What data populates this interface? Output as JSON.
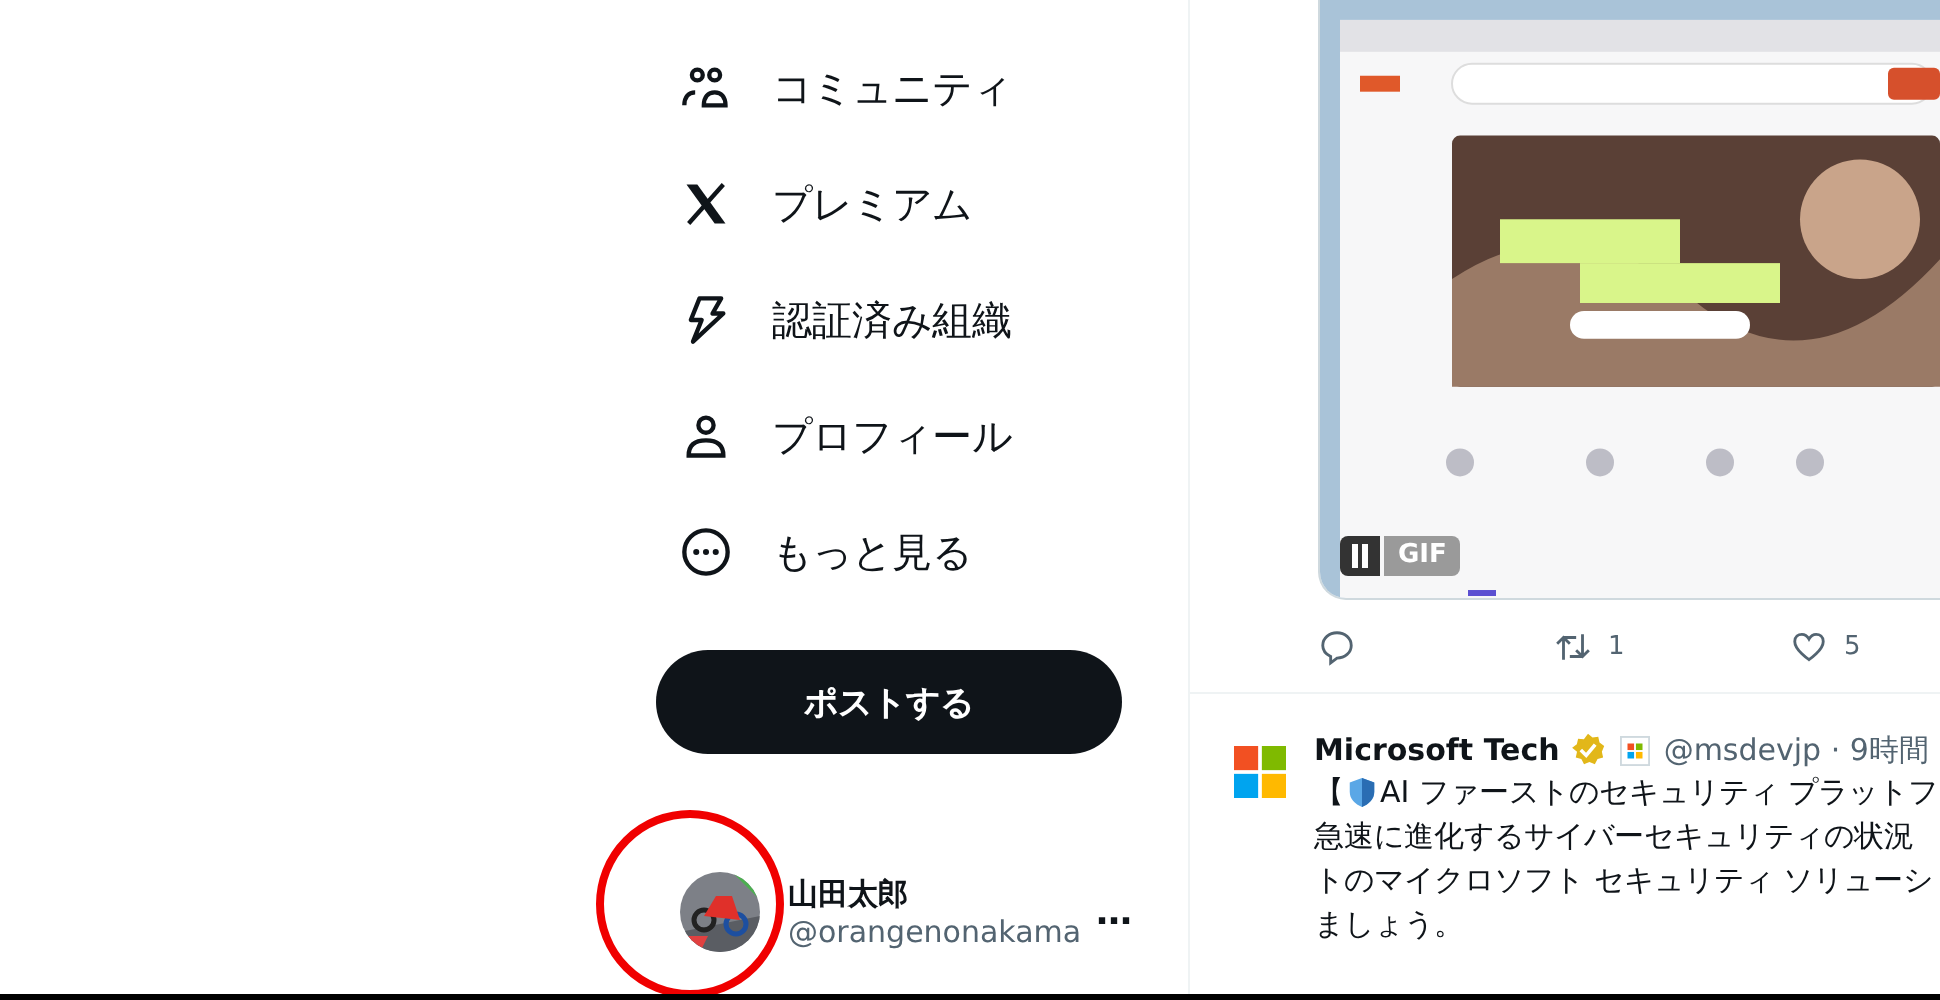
{
  "nav_items": [
    {
      "label": "コミュニティ"
    },
    {
      "label": "プレミアム"
    },
    {
      "label": "認証済み組織"
    },
    {
      "label": "プロフィール"
    },
    {
      "label": "もっと見る"
    }
  ],
  "post_button": "ポストする",
  "account": {
    "name": "山田太郎",
    "handle": "@orangenonakama",
    "more": "…"
  },
  "tweets": [
    {
      "media": {
        "kind": "picture",
        "badge": "GIF"
      },
      "actions": [
        {
          "kind": "reply"
        },
        {
          "kind": "repost",
          "count": "1"
        },
        {
          "kind": "like",
          "count": "5"
        }
      ]
    },
    {
      "author": "Microsoft Tech",
      "verified": true,
      "handle_time": "@msdevjp · 9時間",
      "lead": "【",
      "lines": [
        "AI ファーストのセキュリティ プラットフ",
        "急速に進化するサイバーセキュリティの状況",
        "トのマイクロソフト セキュリティ ソリューシ",
        "ましょう。"
      ]
    }
  ]
}
